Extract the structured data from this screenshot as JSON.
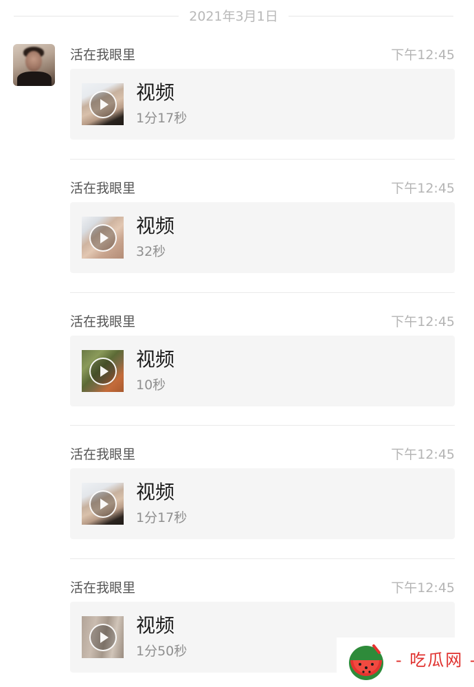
{
  "date_header": "2021年3月1日",
  "colors": {
    "background": "#ffffff",
    "card_background": "#f5f5f5",
    "sender_text": "#555555",
    "time_text": "#b4b4b4",
    "divider": "#eaeaea",
    "watermark_accent": "#e0302d"
  },
  "messages": [
    {
      "sender": "活在我眼里",
      "time": "下午12:45",
      "title": "视频",
      "duration": "1分17秒"
    },
    {
      "sender": "活在我眼里",
      "time": "下午12:45",
      "title": "视频",
      "duration": "32秒"
    },
    {
      "sender": "活在我眼里",
      "time": "下午12:45",
      "title": "视频",
      "duration": "10秒"
    },
    {
      "sender": "活在我眼里",
      "time": "下午12:45",
      "title": "视频",
      "duration": "1分17秒"
    },
    {
      "sender": "活在我眼里",
      "time": "下午12:45",
      "title": "视频",
      "duration": "1分50秒"
    }
  ],
  "watermark": {
    "text": "- 吃瓜网 -",
    "icon": "watermelon-icon"
  },
  "icons": {
    "play": "play-icon",
    "avatar": "avatar"
  }
}
